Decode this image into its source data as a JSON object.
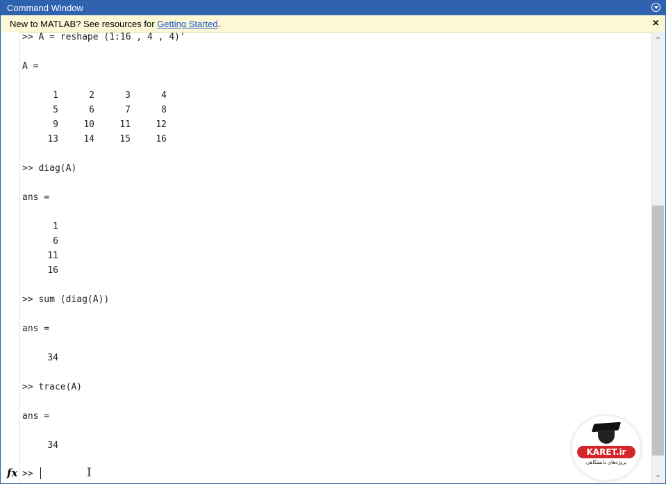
{
  "window": {
    "title": "Command Window"
  },
  "banner": {
    "text_before": "New to MATLAB? See resources for ",
    "link_text": "Getting Started",
    "text_after": ".",
    "close_symbol": "×"
  },
  "console": {
    "cmd1": ">> A = reshape (1:16 , 4 , 4)'",
    "out1_label": "A =",
    "matrix_rows": [
      [
        "1",
        "2",
        "3",
        "4"
      ],
      [
        "5",
        "6",
        "7",
        "8"
      ],
      [
        "9",
        "10",
        "11",
        "12"
      ],
      [
        "13",
        "14",
        "15",
        "16"
      ]
    ],
    "cmd2": ">> diag(A)",
    "out2_label": "ans =",
    "diag_values": [
      "1",
      "6",
      "11",
      "16"
    ],
    "cmd3": ">> sum (diag(A))",
    "out3_label": "ans =",
    "sum_value": "34",
    "cmd4": ">> trace(A)",
    "out4_label": "ans =",
    "trace_value": "34"
  },
  "prompt": {
    "fx_label": "fx",
    "prompt_symbol": ">>"
  },
  "logo": {
    "brand": "KARET.ir",
    "tagline": "پروژه‌های دانشگاهی"
  },
  "icons": {
    "window_menu": "chevron-down-circle-icon",
    "close": "close-icon",
    "scroll_up": "chevron-up-icon",
    "scroll_down": "chevron-down-icon",
    "function_browser": "fx-icon",
    "text_cursor": "ibeam-cursor-icon"
  },
  "colors": {
    "titlebar": "#2f63b0",
    "banner": "#fcf8d6",
    "link": "#1a55cc",
    "logo_red": "#d4252a"
  }
}
